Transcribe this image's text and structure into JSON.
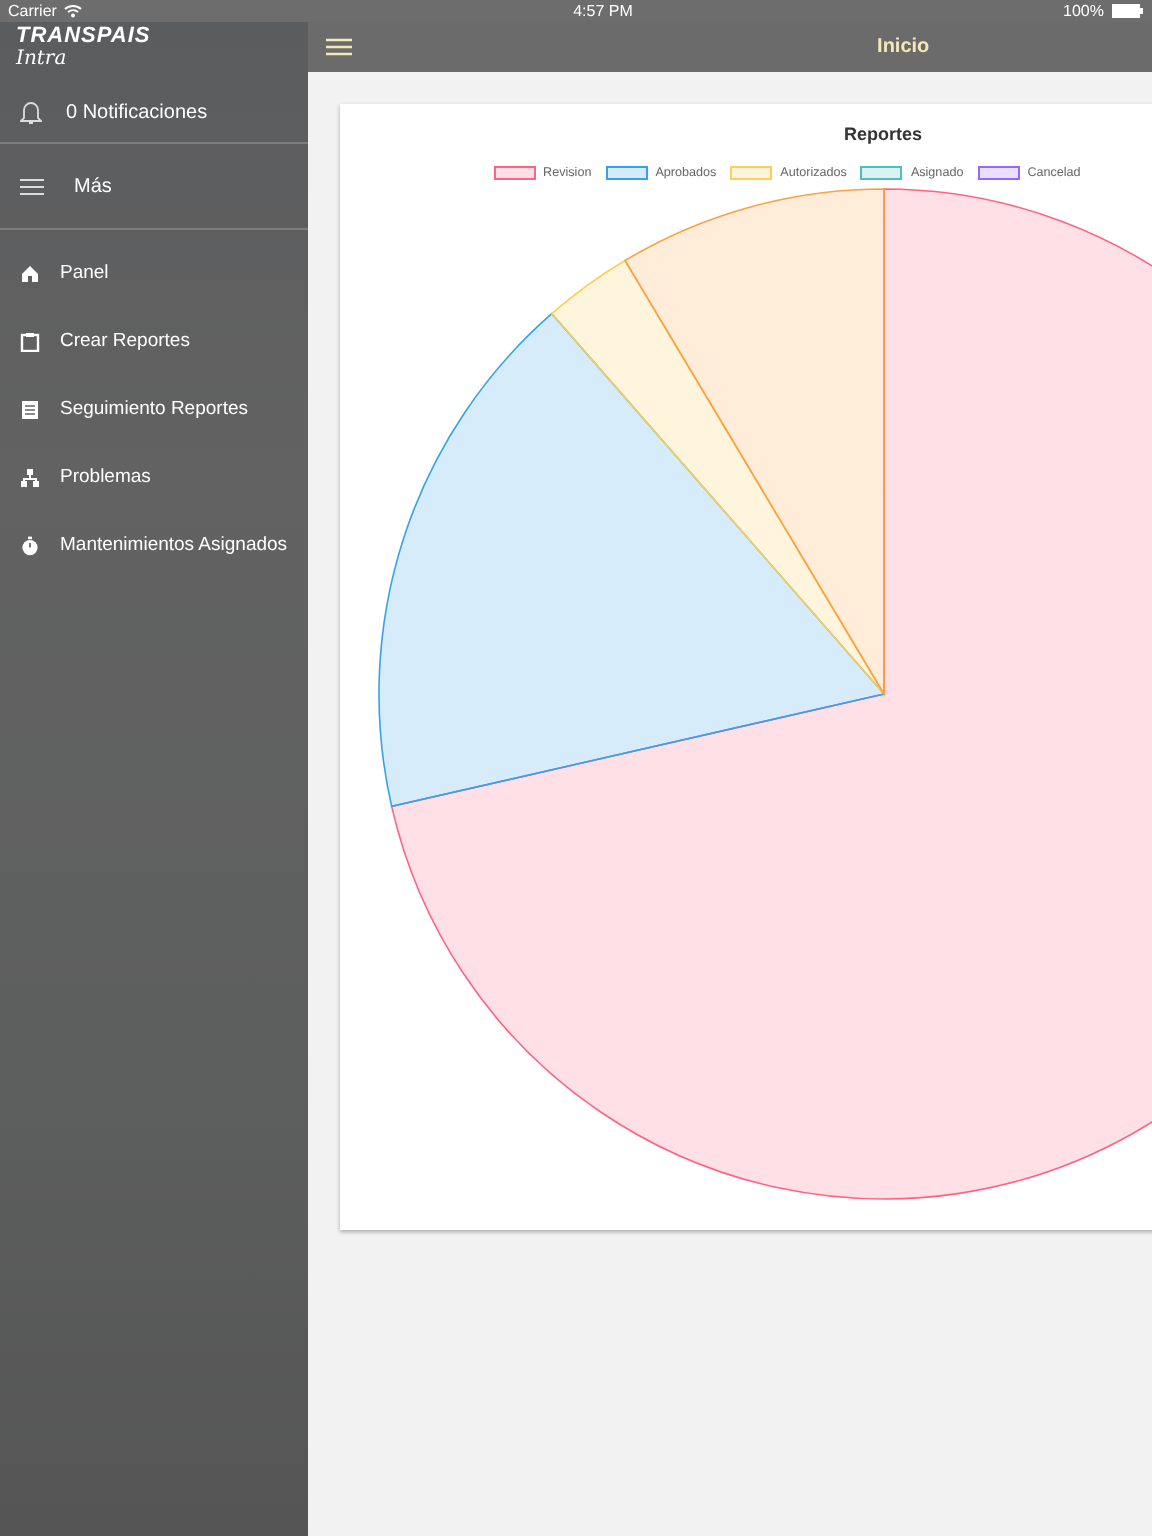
{
  "status_bar": {
    "carrier": "Carrier",
    "time": "4:57 PM",
    "battery": "100%"
  },
  "sidebar": {
    "logo": "TRANSPAIS",
    "logo_sub": "Intra",
    "notifications": "0 Notificaciones",
    "more": "Más",
    "items": [
      {
        "label": "Panel",
        "kind": "home"
      },
      {
        "label": "Crear Reportes",
        "kind": "clipboard"
      },
      {
        "label": "Seguimiento Reportes",
        "kind": "list"
      },
      {
        "label": "Problemas",
        "kind": "network"
      },
      {
        "label": "Mantenimientos Asignados",
        "kind": "stopwatch"
      }
    ]
  },
  "header": {
    "title": "Inicio"
  },
  "card": {
    "title": "Reportes",
    "legend": [
      {
        "label": "Revision",
        "color": "#ff6384"
      },
      {
        "label": "Aprobados",
        "color": "#36a2eb"
      },
      {
        "label": "Autorizados",
        "color": "#ffce56"
      },
      {
        "label": "Asignado",
        "color": "#4bc0c0"
      },
      {
        "label": "Cancelad",
        "color": "#9966ff"
      }
    ]
  }
}
